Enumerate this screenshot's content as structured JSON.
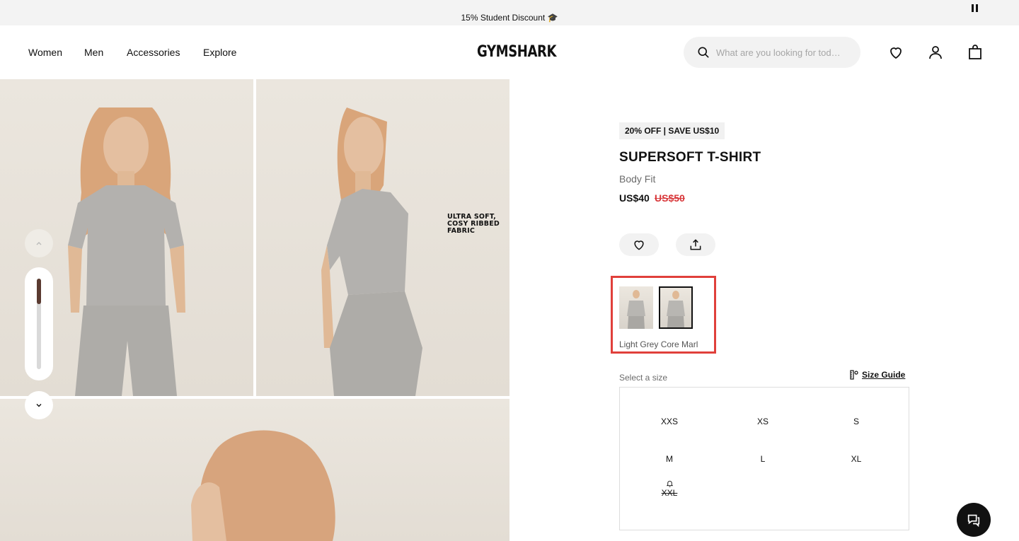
{
  "promo": {
    "text": "15% Student Discount 🎓",
    "pause_icon": "pause-icon"
  },
  "nav": {
    "items": [
      "Women",
      "Men",
      "Accessories",
      "Explore"
    ],
    "logo": "GYMSHARK"
  },
  "search": {
    "placeholder": "What are you looking for tod…",
    "icon": "search-icon"
  },
  "header_icons": [
    "heart-icon",
    "account-icon",
    "bag-icon"
  ],
  "gallery": {
    "caption": "ULTRA SOFT,\nCOSY RIBBED\nFABRIC",
    "scroll_position": 0.0,
    "controls": [
      "chevron-up-icon",
      "chevron-down-icon"
    ]
  },
  "product": {
    "badge": "20% OFF | SAVE US$10",
    "title": "SUPERSOFT T-SHIRT",
    "fit": "Body Fit",
    "price": "US$40",
    "price_was": "US$50",
    "actions": [
      "wishlist-heart-icon",
      "share-icon"
    ]
  },
  "colours": {
    "selected_name": "Light Grey Core Marl",
    "selected_index": 1,
    "count": 2
  },
  "sizes": {
    "label": "Select a size",
    "guide_label": "Size Guide",
    "options": [
      {
        "size": "XXS",
        "available": true
      },
      {
        "size": "XS",
        "available": true
      },
      {
        "size": "S",
        "available": true
      },
      {
        "size": "M",
        "available": true
      },
      {
        "size": "L",
        "available": true
      },
      {
        "size": "XL",
        "available": true
      },
      {
        "size": "XXL",
        "available": false
      }
    ]
  },
  "colors": {
    "accent_red": "#d8373a",
    "highlight_border": "#e0403b",
    "badge_bg": "#f1f1f1",
    "chat_bg": "#111111"
  }
}
